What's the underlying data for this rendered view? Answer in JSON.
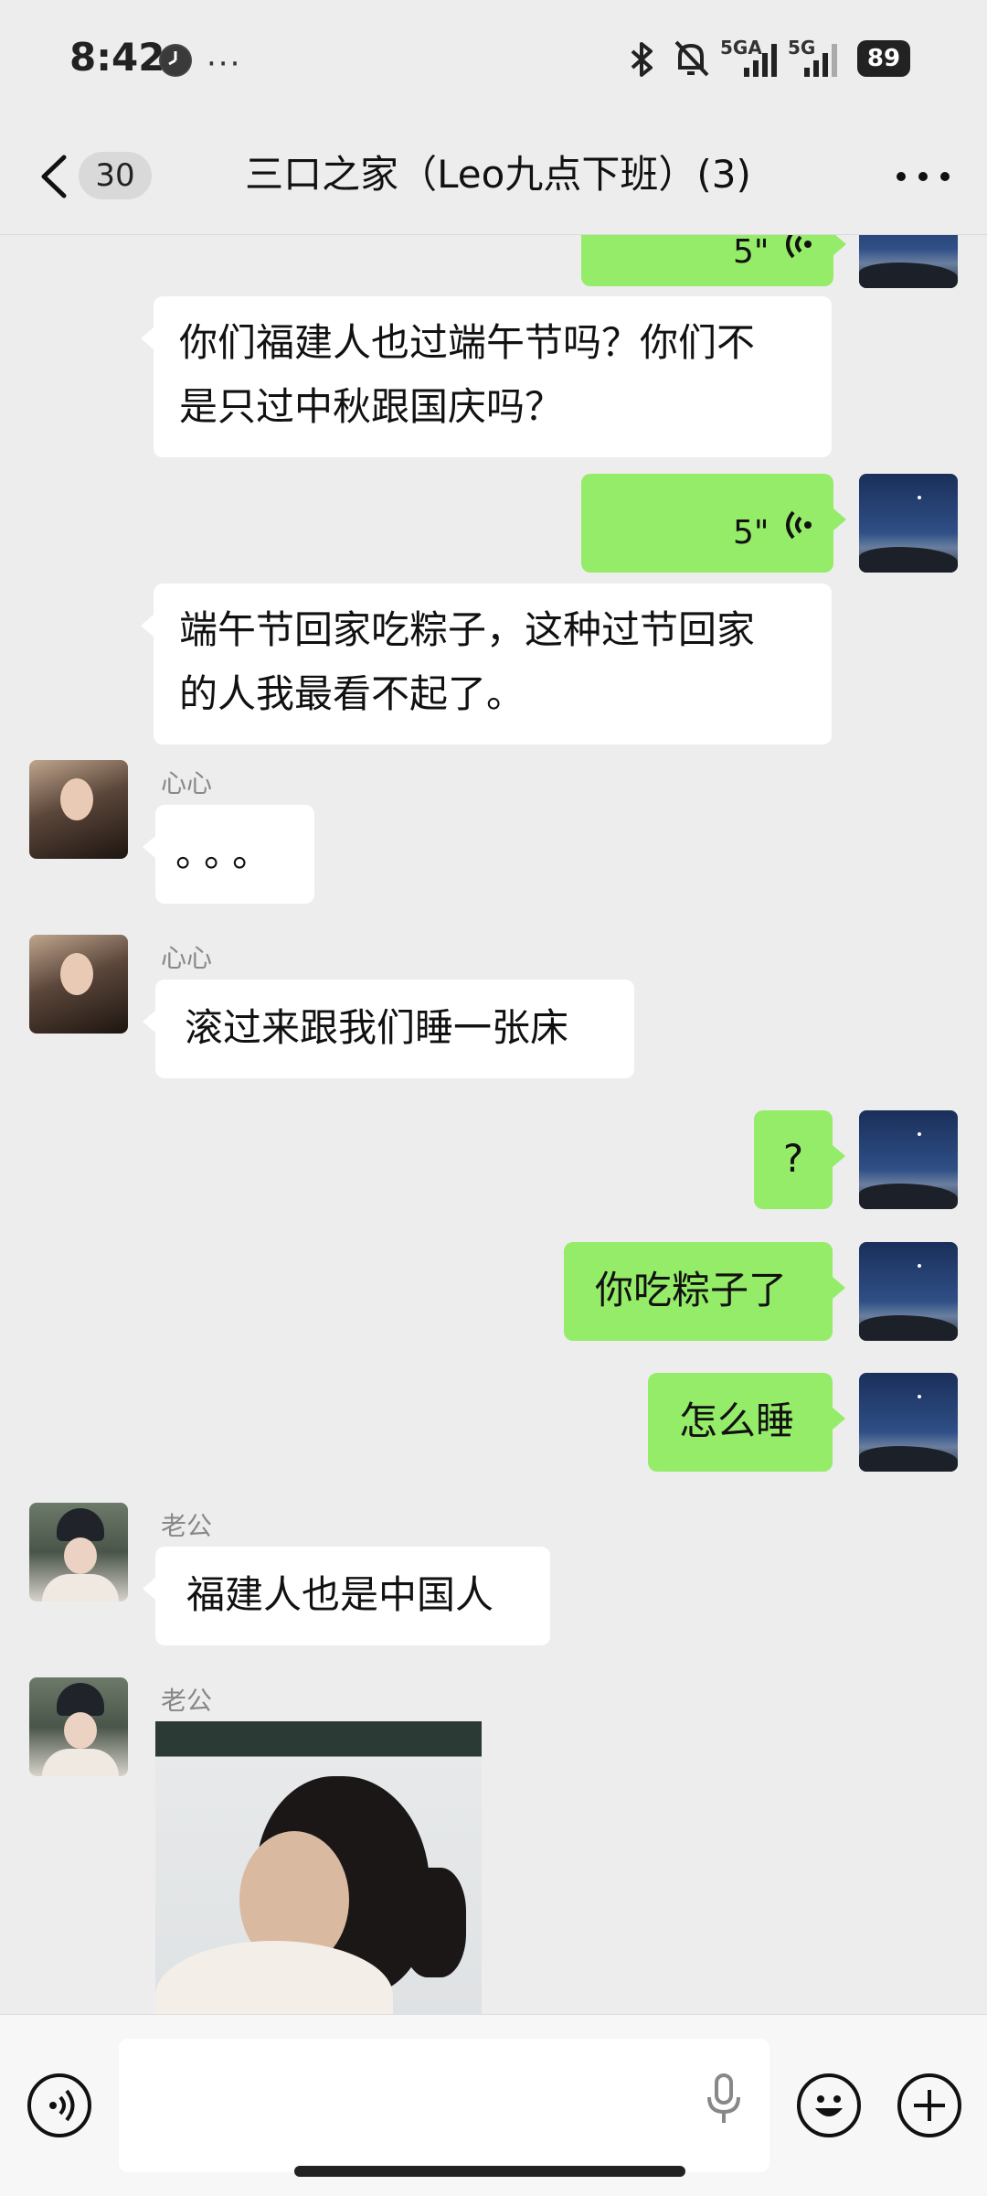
{
  "status_bar": {
    "time": "8:42",
    "net1": "5GA",
    "net2": "5G",
    "battery": "89",
    "icons": [
      "clock-icon",
      "more-dots-icon",
      "bluetooth-icon",
      "mute-icon",
      "signal-icon",
      "signal-icon",
      "battery-icon"
    ]
  },
  "nav": {
    "unread_count": "30",
    "title": "三口之家（Leo九点下班）(3)",
    "back_icon": "chevron-left-icon",
    "more_icon": "more-dots-icon"
  },
  "messages": [
    {
      "side": "right",
      "type": "voice",
      "duration": "5\"",
      "partial": true
    },
    {
      "side": "left",
      "type": "text",
      "text_line1": "你们福建人也过端午节吗？你们不",
      "text_line2": "是只过中秋跟国庆吗？"
    },
    {
      "side": "right",
      "type": "voice",
      "duration": "5\""
    },
    {
      "side": "left",
      "type": "text",
      "text_line1": "端午节回家吃粽子，这种过节回家",
      "text_line2": "的人我最看不起了。"
    },
    {
      "side": "left",
      "sender": "心心",
      "type": "text",
      "text": "。。。"
    },
    {
      "side": "left",
      "sender": "心心",
      "type": "text",
      "text": "滚过来跟我们睡一张床"
    },
    {
      "side": "right",
      "type": "text",
      "text": "?"
    },
    {
      "side": "right",
      "type": "text",
      "text": "你吃粽子了"
    },
    {
      "side": "right",
      "type": "text",
      "text": "怎么睡"
    },
    {
      "side": "left",
      "sender": "老公",
      "type": "text",
      "text": "福建人也是中国人"
    },
    {
      "side": "left",
      "sender": "老公",
      "type": "image"
    }
  ],
  "input_bar": {
    "voice_icon": "voice-mode-icon",
    "mic_icon": "microphone-icon",
    "emoji_icon": "emoji-icon",
    "plus_icon": "plus-icon",
    "input_value": "",
    "input_placeholder": ""
  },
  "colors": {
    "background": "#ededed",
    "sent_bubble": "#95ec69",
    "received_bubble": "#ffffff"
  }
}
